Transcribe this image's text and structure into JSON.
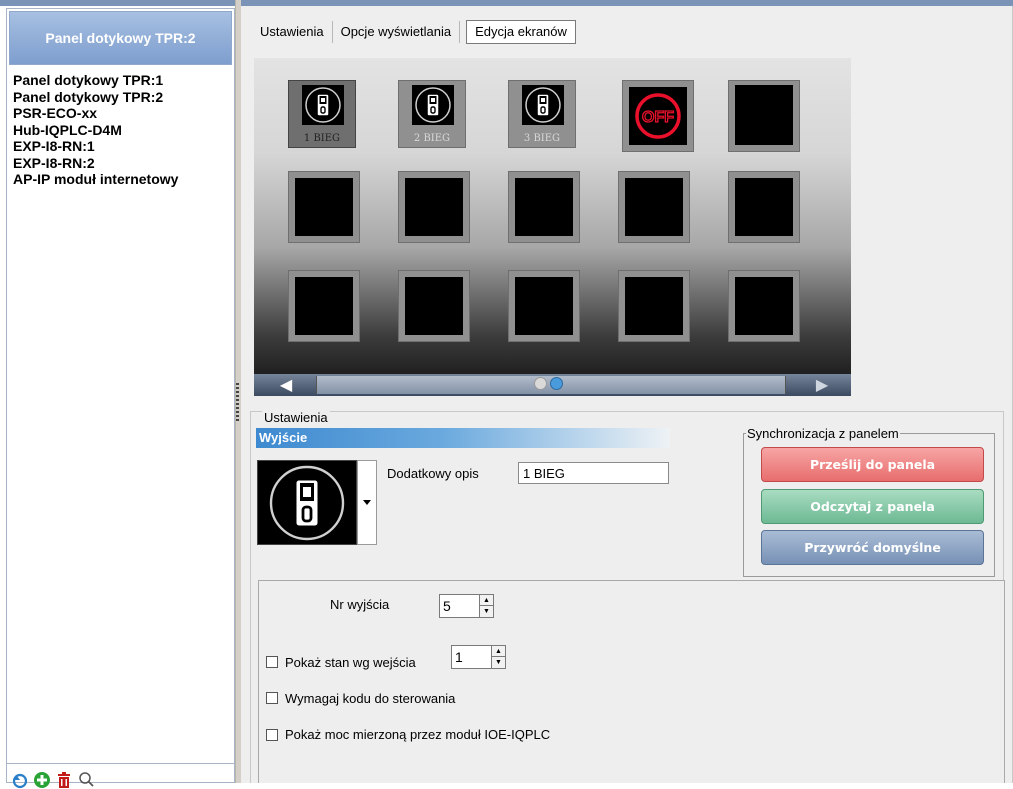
{
  "sidebar": {
    "header": "Panel dotykowy TPR:2",
    "items": [
      "Panel dotykowy TPR:1",
      "Panel dotykowy TPR:2",
      "PSR-ECO-xx",
      "Hub-IQPLC-D4M",
      "EXP-I8-RN:1",
      "EXP-I8-RN:2",
      "AP-IP moduł internetowy"
    ],
    "tools": [
      "refresh-icon",
      "add-icon",
      "delete-icon",
      "search-icon"
    ]
  },
  "tabs": [
    {
      "label": "Ustawienia",
      "active": false
    },
    {
      "label": "Opcje wyświetlania",
      "active": false
    },
    {
      "label": "Edycja  ekranów",
      "active": true
    }
  ],
  "screen": {
    "tiles_row1": [
      {
        "label": "1 BIEG",
        "icon": "switch-icon",
        "selected": true
      },
      {
        "label": "2 BIEG",
        "icon": "switch-icon",
        "selected": false
      },
      {
        "label": "3 BIEG",
        "icon": "switch-icon",
        "selected": false
      },
      {
        "label": "OFF",
        "icon": "off-icon",
        "selected": false
      },
      {
        "label": "",
        "icon": "",
        "selected": false
      }
    ],
    "rows": 3,
    "columns": 5,
    "page_count": 2,
    "current_page": 2
  },
  "settings": {
    "legend": "Ustawienia",
    "output_header": "Wyjście",
    "extra_desc_label": "Dodatkowy opis",
    "extra_desc_value": "1 BIEG",
    "output_no_label": "Nr wyjścia",
    "output_no_value": "5",
    "show_state_label": "Pokaż stan wg wejścia",
    "show_state_value": "1",
    "require_code_label": "Wymagaj kodu do sterowania",
    "show_power_label": "Pokaż moc mierzoną przez moduł IOE-IQPLC"
  },
  "sync": {
    "legend": "Synchronizacja z panelem",
    "send_label": "Prześlij do panela",
    "read_label": "Odczytaj z panela",
    "restore_label": "Przywróć domyślne"
  },
  "colors": {
    "header_blue": "#7e9ece",
    "send_red": "#e86d6d",
    "read_green": "#6db994",
    "restore_blue": "#7791b5",
    "page_dot_active": "#4a9bdc"
  }
}
